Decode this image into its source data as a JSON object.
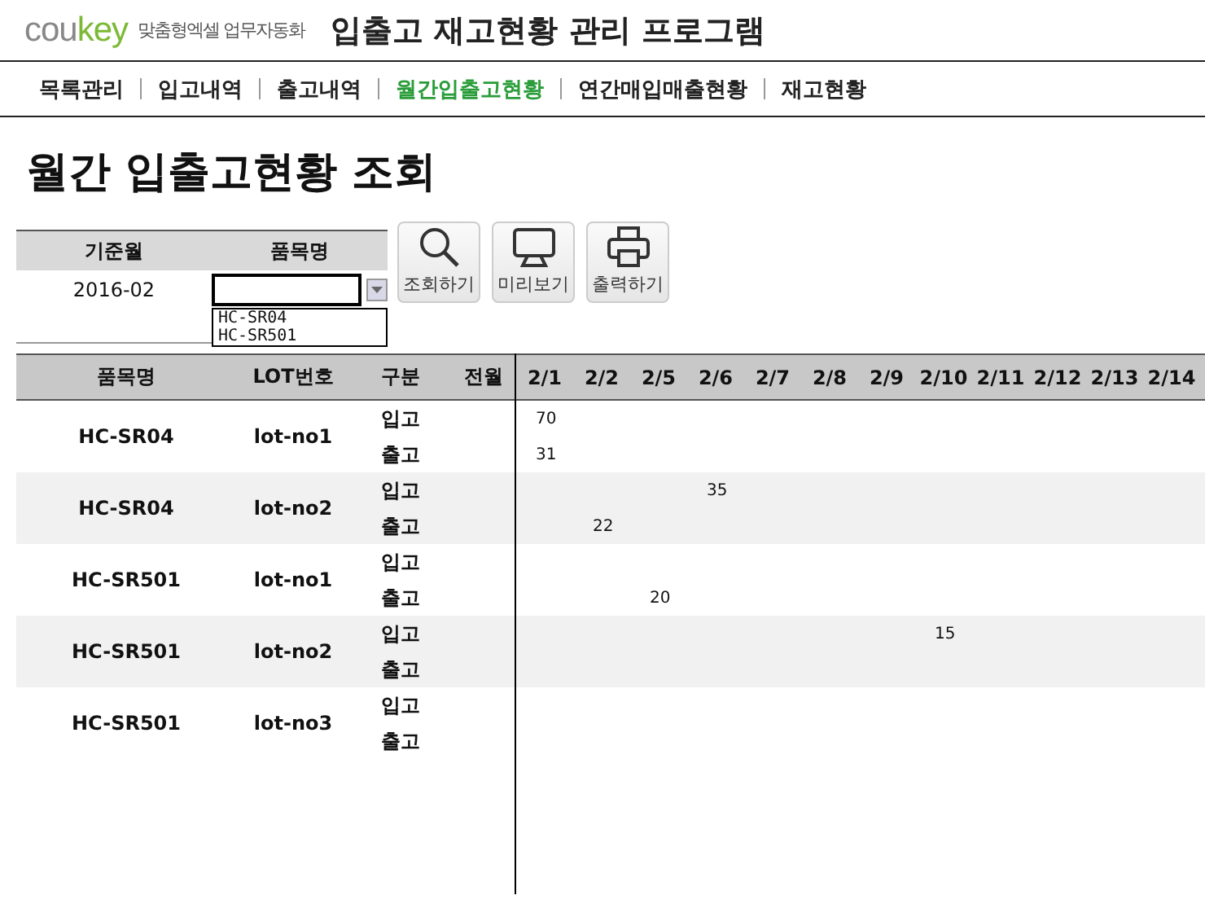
{
  "header": {
    "logo": "coukey",
    "tagline": "맞춤형엑셀 업무자동화",
    "title": "입출고 재고현황 관리 프로그램"
  },
  "nav": [
    {
      "label": "목록관리",
      "selected": false
    },
    {
      "label": "입고내역",
      "selected": false
    },
    {
      "label": "출고내역",
      "selected": false
    },
    {
      "label": "월간입출고현황",
      "selected": true
    },
    {
      "label": "연간매입매출현황",
      "selected": false
    },
    {
      "label": "재고현황",
      "selected": false
    }
  ],
  "page_title": "월간 입출고현황 조회",
  "filter": {
    "month_label": "기준월",
    "item_label": "품목명",
    "month_value": "2016-02",
    "item_dropdown": {
      "expanded": true,
      "options": [
        "HC-SR04",
        "HC-SR501"
      ]
    }
  },
  "buttons": [
    {
      "kind": "search",
      "label": "조회하기"
    },
    {
      "kind": "preview",
      "label": "미리보기"
    },
    {
      "kind": "print",
      "label": "출력하기"
    }
  ],
  "table": {
    "columns": [
      "품목명",
      "LOT번호",
      "구분",
      "전월"
    ],
    "dates": [
      "2/1",
      "2/2",
      "2/5",
      "2/6",
      "2/7",
      "2/8",
      "2/9",
      "2/10",
      "2/11",
      "2/12",
      "2/13",
      "2/14"
    ],
    "groups": [
      {
        "item": "HC-SR04",
        "lot": "lot-no1",
        "lines": [
          {
            "type": "입고",
            "values": {
              "col_1": "70"
            }
          },
          {
            "type": "출고",
            "values": {
              "col_1": "31"
            }
          }
        ]
      },
      {
        "item": "HC-SR04",
        "lot": "lot-no2",
        "lines": [
          {
            "type": "입고",
            "values": {
              "col_4": "35"
            }
          },
          {
            "type": "출고",
            "values": {
              "col_2": "22"
            }
          }
        ]
      },
      {
        "item": "HC-SR501",
        "lot": "lot-no1",
        "lines": [
          {
            "type": "입고"
          },
          {
            "type": "출고",
            "values": {
              "col_3": "20"
            }
          }
        ]
      },
      {
        "item": "HC-SR501",
        "lot": "lot-no2",
        "lines": [
          {
            "type": "입고",
            "values": {
              "col_8": "15"
            }
          },
          {
            "type": "출고"
          }
        ]
      },
      {
        "item": "HC-SR501",
        "lot": "lot-no3",
        "lines": [
          {
            "type": "입고"
          },
          {
            "type": "출고"
          }
        ]
      }
    ]
  }
}
